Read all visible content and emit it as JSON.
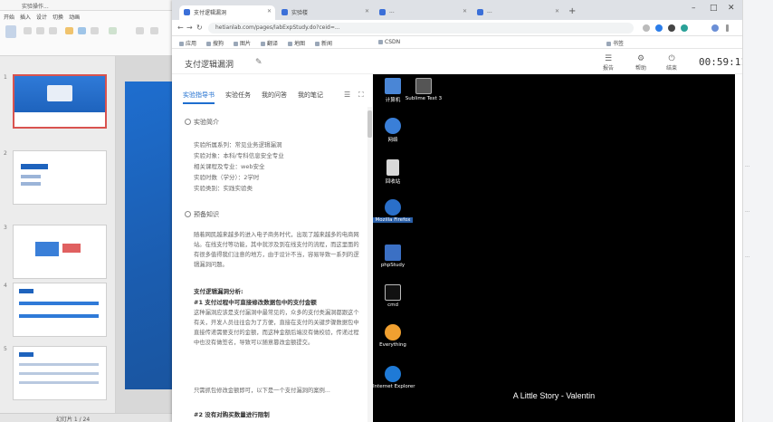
{
  "ppt": {
    "title": "实验操作...",
    "tabs": [
      "开始",
      "插入",
      "设计",
      "切换",
      "动画"
    ],
    "slide_numbers": [
      "1",
      "2",
      "3",
      "4",
      "5"
    ],
    "status": "幻灯片 1 / 24"
  },
  "browser": {
    "tabs": [
      {
        "label": "支付逻辑漏洞"
      },
      {
        "label": "实验楼"
      },
      {
        "label": "..."
      },
      {
        "label": "..."
      }
    ],
    "url": "hetianlab.com/pages/labExpStudy.do?ceid=...",
    "bookmarks": [
      "应用",
      "搜狗",
      "图片",
      "翻译",
      "地图",
      "新闻",
      "CSDN",
      "书签"
    ],
    "newtab_glyph": "+"
  },
  "page": {
    "title": "支付逻辑漏洞",
    "title_icon": "✎",
    "header_actions": [
      {
        "icon": "☰",
        "label": "报告"
      },
      {
        "icon": "⚙",
        "label": "帮助"
      },
      {
        "icon": "⏻",
        "label": "结束"
      }
    ],
    "timer": "00:59:11",
    "tabs": [
      "实验指导书",
      "实验任务",
      "我的问答",
      "我的笔记"
    ],
    "sec1_title": "实验简介",
    "kv": [
      "实验所属系列：常见业务逻辑漏洞",
      "实验对象：本科/专科信息安全专业",
      "相关课程及专业：web安全",
      "实验时数（学分）：2学时",
      "实验类别：实践实验类"
    ],
    "sec2_title": "预备知识",
    "para1": "随着网民越来越多的进入电子商务时代，出现了越来越多的电商网站。在线支付等功能，其中就涉及到在线支付的流程，而这里面的有很多值得我们注意的地方，由于设计不当，容易导致一系列的逻辑漏洞问题。",
    "bold1": "支付逻辑漏洞分析:",
    "bold2": "#1 支付过程中可直接修改数据包中的支付金额",
    "para2": "这种漏洞应该是支付漏洞中最常见的，众多的支付类漏洞都跟这个有关，开发人员往往会为了方便，直接在支付的关键步骤数据包中直接传递需要支付的金额，而这种金额后端没有做校验，传递过程中也没有做签名，导致可以随意篡改金额提交。",
    "para3": "只需抓包修改金额即可，以下是一个支付漏洞的案例...",
    "bold3": "#2 没有对购买数量进行限制"
  },
  "vm": {
    "icons": [
      {
        "label": "计算机"
      },
      {
        "label": "Sublime Text 3"
      },
      {
        "label": "网络"
      },
      {
        "label": "回收站"
      },
      {
        "label": "Mozilla Firefox"
      },
      {
        "label": "phpStudy"
      },
      {
        "label": "cmd"
      },
      {
        "label": "Everything"
      },
      {
        "label": "Internet Explorer"
      }
    ],
    "caption": "A Little Story - Valentin"
  },
  "right_strip": {
    "items": [
      "...",
      "...",
      "..."
    ]
  }
}
